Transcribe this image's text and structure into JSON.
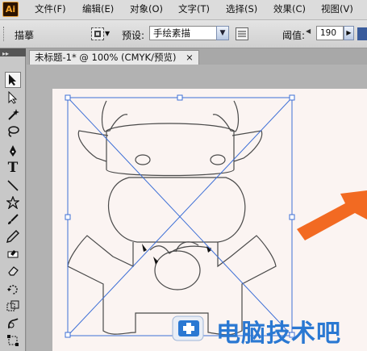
{
  "app": {
    "logo": "Ai",
    "menu": [
      {
        "label": "文件(F)"
      },
      {
        "label": "编辑(E)"
      },
      {
        "label": "对象(O)"
      },
      {
        "label": "文字(T)"
      },
      {
        "label": "选择(S)"
      },
      {
        "label": "效果(C)"
      },
      {
        "label": "视图(V)"
      }
    ]
  },
  "control_bar": {
    "tool_name": "描摹",
    "preset_label": "预设:",
    "preset_value": "手绘素描",
    "threshold_label": "阈值:",
    "threshold_value": "190"
  },
  "document": {
    "tab_title": "未标题-1* @ 100% (CMYK/预览)",
    "tab_close": "×"
  },
  "watermark": {
    "text": "电脑技术吧"
  },
  "colors": {
    "accent_arrow": "#f26a22",
    "selection": "#3d6fd6",
    "brand_blue": "#2a78d2"
  }
}
